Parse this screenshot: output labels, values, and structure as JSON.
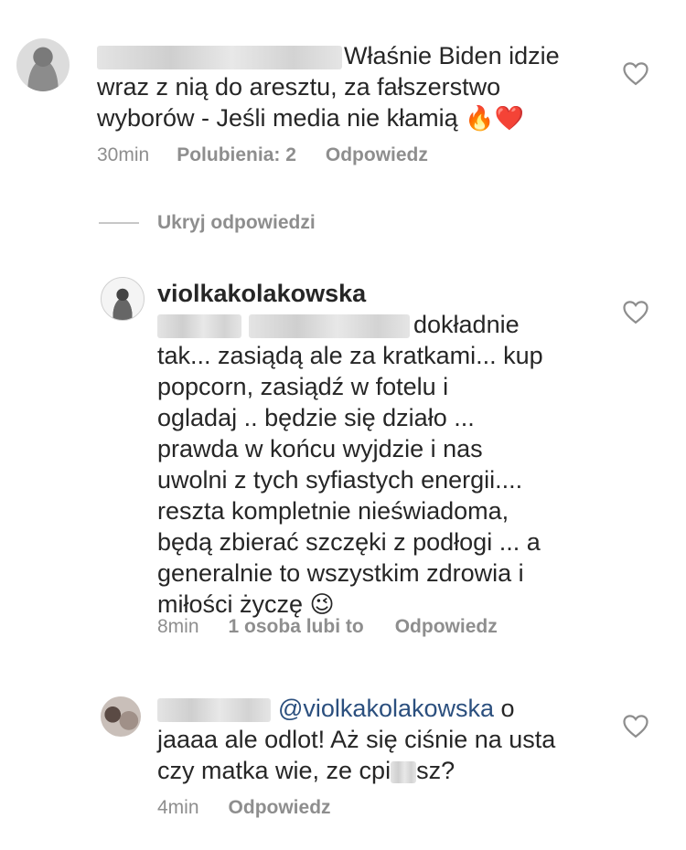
{
  "comments": [
    {
      "text": "Właśnie Biden idzie wraz z nią do aresztu, za fałszerstwo wyborów - Jeśli media nie kłamią",
      "emoji": [
        "🔥",
        "❤️"
      ],
      "time": "30min",
      "likes": "Polubienia: 2",
      "reply": "Odpowiedz"
    },
    {
      "username": "violkakolakowska",
      "text_first": "dokładnie",
      "lines": [
        "tak... zasiądą ale za kratkami... kup",
        "popcorn, zasiądź w fotelu i",
        "ogladaj .. będzie się działo ...",
        "prawda w końcu wyjdzie i nas",
        "uwolni z tych syfiastych energii....",
        "reszta kompletnie nieświadoma,",
        "będą zbierać szczęki z podłogi ... a",
        "generalnie to wszystkim zdrowia i",
        "miłości życzę"
      ],
      "emoji": "😉",
      "time": "8min",
      "likes": "1 osoba lubi to",
      "reply": "Odpowiedz"
    },
    {
      "mention": "@violkakolakowska",
      "text_first": "o",
      "lines": [
        "jaaaa ale odlot! Aż się ciśnie na usta",
        "czy matka wie, ze cpi",
        "sz?"
      ],
      "time": "4min",
      "reply": "Odpowiedz"
    }
  ],
  "hide_replies": "Ukryj odpowiedzi",
  "icons": {
    "like": "heart-outline-icon"
  }
}
